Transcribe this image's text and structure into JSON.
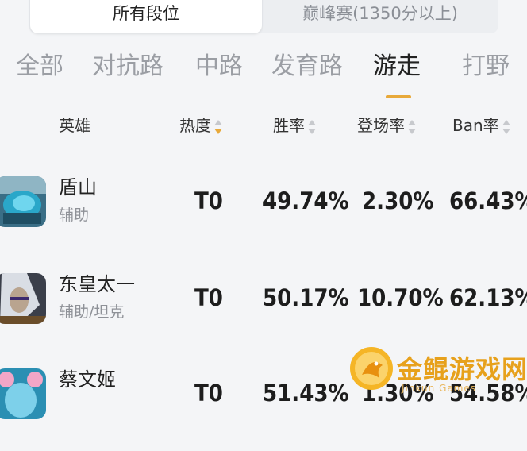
{
  "filter": {
    "all_ranks": "所有段位",
    "peak": "巅峰赛(1350分以上)"
  },
  "tabs": [
    "全部",
    "对抗路",
    "中路",
    "发育路",
    "游走",
    "打野"
  ],
  "active_tab": "游走",
  "columns": {
    "hero": "英雄",
    "heat": "热度",
    "win_rate": "胜率",
    "pick_rate": "登场率",
    "ban_rate": "Ban率"
  },
  "heroes": [
    {
      "name": "盾山",
      "role": "辅助",
      "tier": "T0",
      "win_rate": "49.74%",
      "pick_rate": "2.30%",
      "ban_rate": "66.43%"
    },
    {
      "name": "东皇太一",
      "role": "辅助/坦克",
      "tier": "T0",
      "win_rate": "50.17%",
      "pick_rate": "10.70%",
      "ban_rate": "62.13%"
    },
    {
      "name": "蔡文姬",
      "role": "",
      "tier": "T0",
      "win_rate": "51.43%",
      "pick_rate": "1.30%",
      "ban_rate": "54.58%"
    }
  ],
  "watermark": {
    "title": "金鲲游戏网",
    "subtitle": "Jinkun Games"
  },
  "colors": {
    "accent": "#e8a93a",
    "watermark": "#e7a11c"
  }
}
